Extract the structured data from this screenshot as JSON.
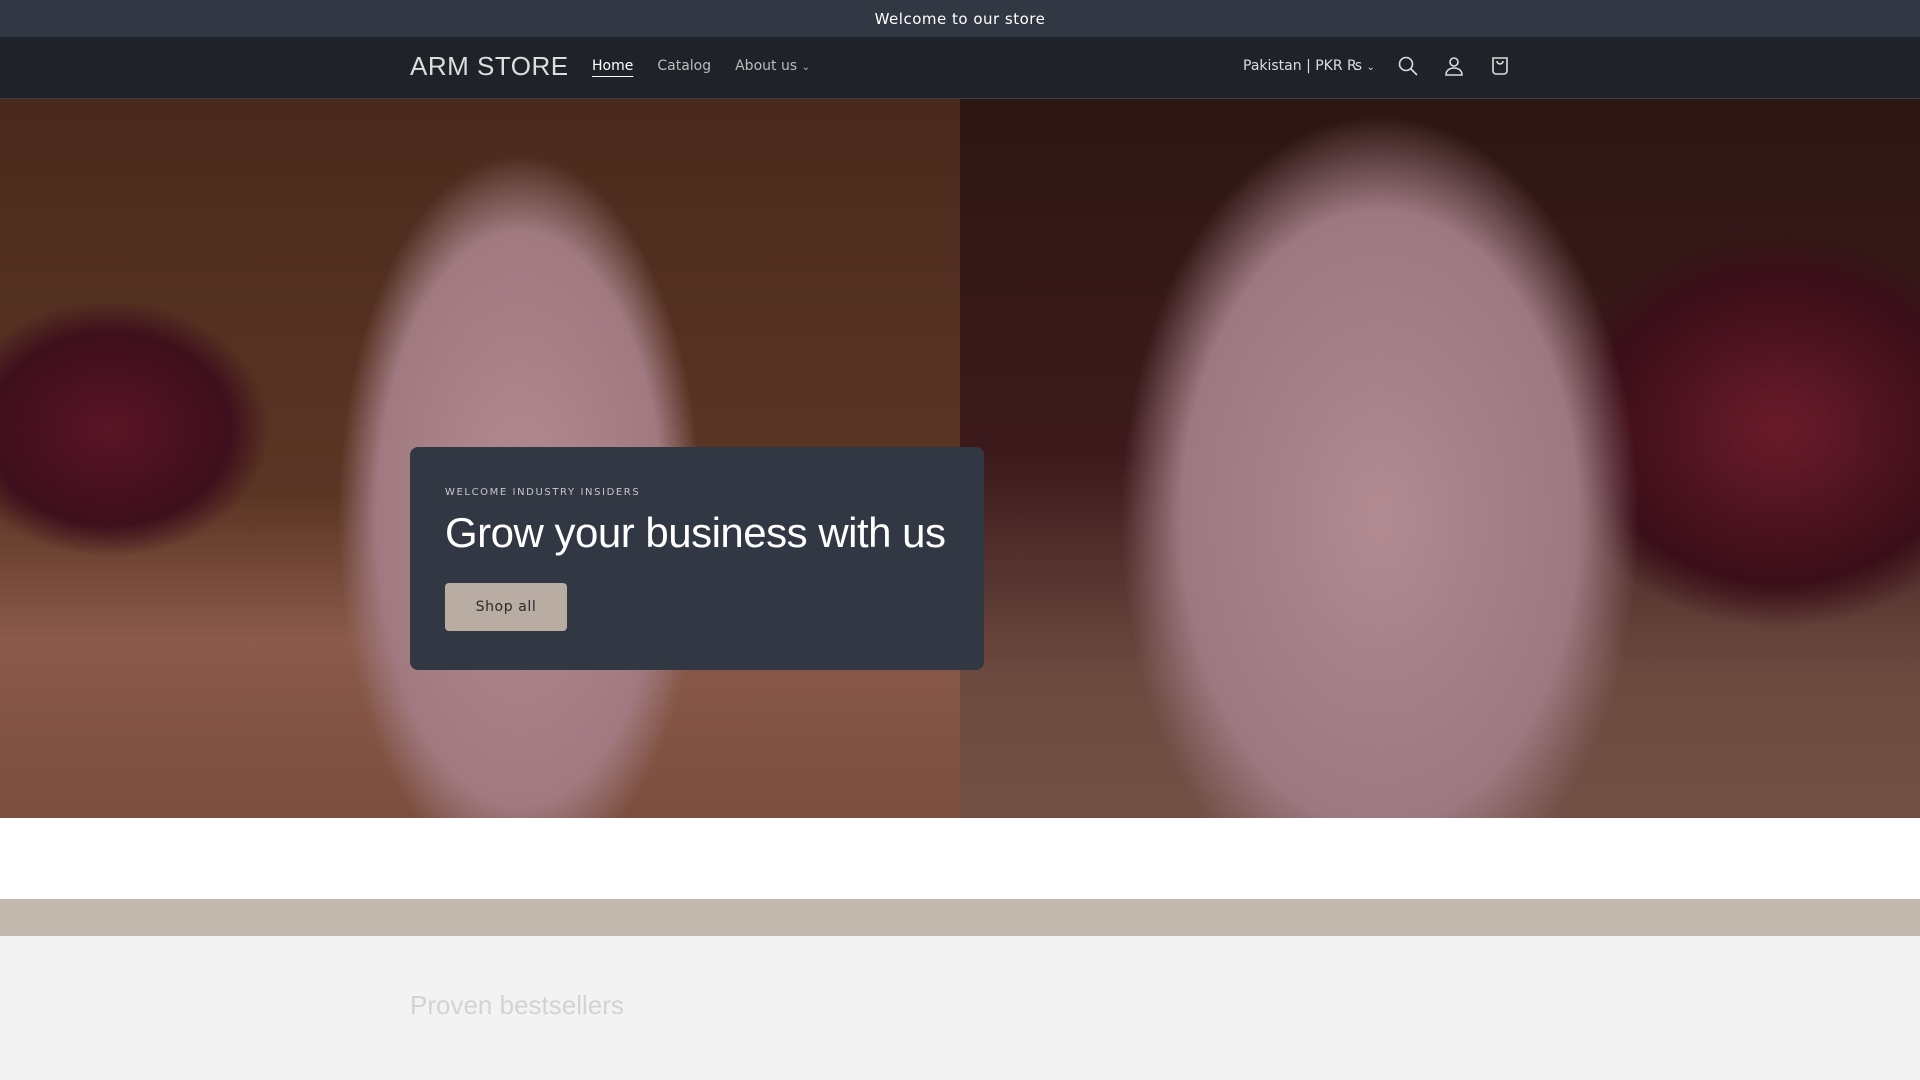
{
  "announcement": "Welcome to our store",
  "header": {
    "logo": "ARM STORE",
    "nav": [
      {
        "label": "Home"
      },
      {
        "label": "Catalog"
      },
      {
        "label": "About us"
      }
    ],
    "locale": "Pakistan | PKR ₨"
  },
  "hero": {
    "eyebrow": "WELCOME INDUSTRY INSIDERS",
    "title": "Grow your business with us",
    "button": "Shop all"
  },
  "sections": {
    "bestsellers_title": "Proven bestsellers"
  },
  "colors": {
    "announcement_bg": "#323843",
    "header_bg": "#1f2329",
    "button_bg": "#b8aca3",
    "band": "#c2b8ae"
  }
}
